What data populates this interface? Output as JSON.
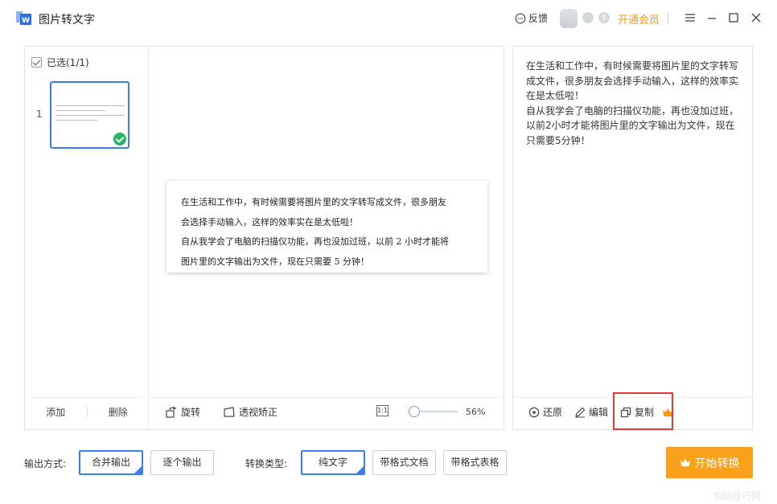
{
  "app": {
    "title": "图片转文字"
  },
  "titlebar": {
    "feedback_label": "反馈",
    "vip_label": "开通会员",
    "badge2": "$"
  },
  "colors": {
    "accent": "#3d7cf0",
    "vip": "#f29b0f",
    "start_button": "#f9a11b",
    "success": "#28b463",
    "highlight": "#e53935"
  },
  "thumbs_panel": {
    "selected_label": "已选(1/1)",
    "items": [
      {
        "number": "1",
        "selected": true
      }
    ],
    "add_label": "添加",
    "delete_label": "删除"
  },
  "preview": {
    "doc_lines": [
      "在生活和工作中，有时候需要将图片里的文字转写成文件，很多朋友",
      "会选择手动输入，这样的效率实在是太低啦！",
      "自从我学会了电脑的扫描仪功能，再也没加过班，以前 2 小时才能将",
      "图片里的文字输出为文件，现在只需要 5 分钟！"
    ],
    "rotate_label": "旋转",
    "perspective_label": "透视矫正",
    "zoom_icon_text": "1:1",
    "zoom_percent": "56%"
  },
  "result": {
    "lines": [
      "在生活和工作中，有时候需要将图片里的文字转写",
      "成文件，很多朋友会选择手动输入，这样的效率实",
      "在是太低啦！",
      "自从我学会了电脑的扫描仪功能，再也没加过班，",
      "以前2小时才能将图片里的文字输出为文件，现在",
      "只需要5分钟！"
    ],
    "restore_label": "还原",
    "edit_label": "编辑",
    "copy_label": "复制"
  },
  "bottom": {
    "output_mode_label": "输出方式:",
    "output_options": [
      "合并输出",
      "逐个输出"
    ],
    "output_selected": "合并输出",
    "convert_type_label": "转换类型:",
    "convert_options": [
      "纯文字",
      "带格式文档",
      "带格式表格"
    ],
    "convert_selected": "纯文字",
    "start_label": "开始转换"
  },
  "watermark": "电脑技巧网"
}
